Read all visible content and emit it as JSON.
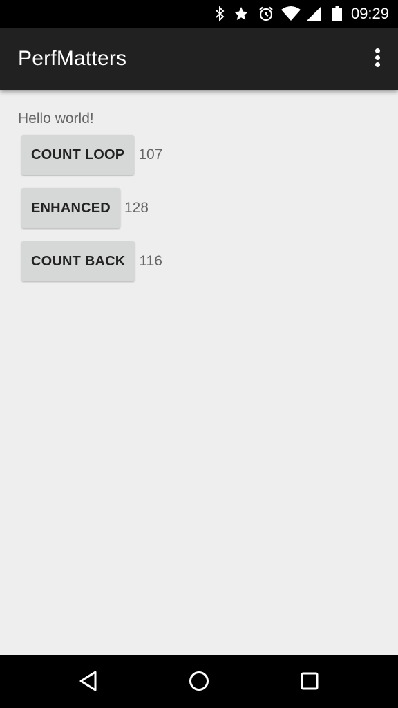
{
  "status_bar": {
    "time": "09:29",
    "icons": [
      "bluetooth-icon",
      "star-icon",
      "alarm-icon",
      "wifi-icon",
      "signal-icon",
      "battery-icon"
    ]
  },
  "app_bar": {
    "title": "PerfMatters",
    "overflow_icon": "overflow-menu-icon"
  },
  "content": {
    "greeting": "Hello world!",
    "rows": [
      {
        "button_label": "COUNT LOOP",
        "value": "107"
      },
      {
        "button_label": "ENHANCED",
        "value": "128"
      },
      {
        "button_label": "COUNT BACK",
        "value": "116"
      }
    ]
  },
  "nav_bar": {
    "icons": [
      "back-icon",
      "home-icon",
      "recents-icon"
    ]
  },
  "colors": {
    "status_bar_bg": "#000000",
    "app_bar_bg": "#212121",
    "content_bg": "#eeeeee",
    "button_bg": "#d6d7d7"
  }
}
